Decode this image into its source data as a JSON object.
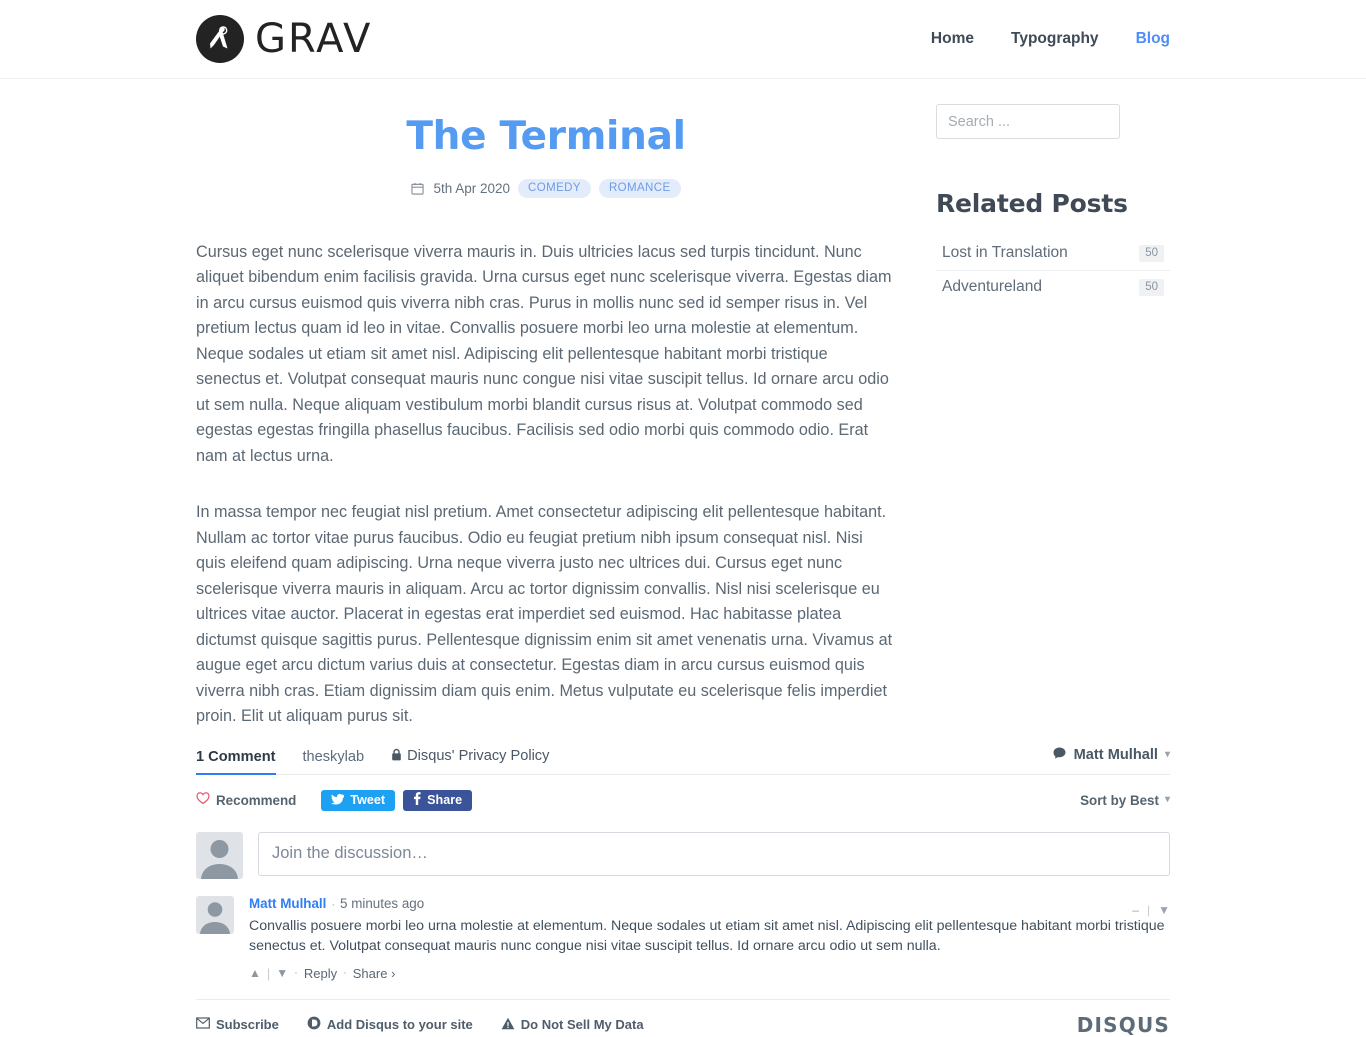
{
  "brand": {
    "word": "GRAV",
    "mark_icon": "grav-compass-logo"
  },
  "nav": {
    "items": [
      {
        "label": "Home",
        "active": false
      },
      {
        "label": "Typography",
        "active": false
      },
      {
        "label": "Blog",
        "active": true
      }
    ]
  },
  "post": {
    "title": "The Terminal",
    "date": "5th Apr 2020",
    "date_icon": "calendar-icon",
    "tags": [
      "COMEDY",
      "ROMANCE"
    ],
    "paragraphs": [
      "Cursus eget nunc scelerisque viverra mauris in. Duis ultricies lacus sed turpis tincidunt. Nunc aliquet bibendum enim facilisis gravida. Urna cursus eget nunc scelerisque viverra. Egestas diam in arcu cursus euismod quis viverra nibh cras. Purus in mollis nunc sed id semper risus in. Vel pretium lectus quam id leo in vitae. Convallis posuere morbi leo urna molestie at elementum. Neque sodales ut etiam sit amet nisl. Adipiscing elit pellentesque habitant morbi tristique senectus et. Volutpat consequat mauris nunc congue nisi vitae suscipit tellus. Id ornare arcu odio ut sem nulla. Neque aliquam vestibulum morbi blandit cursus risus at. Volutpat commodo sed egestas egestas fringilla phasellus faucibus. Facilisis sed odio morbi quis commodo odio. Erat nam at lectus urna.",
      "In massa tempor nec feugiat nisl pretium. Amet consectetur adipiscing elit pellentesque habitant. Nullam ac tortor vitae purus faucibus. Odio eu feugiat pretium nibh ipsum consequat nisl. Nisi quis eleifend quam adipiscing. Urna neque viverra justo nec ultrices dui. Cursus eget nunc scelerisque viverra mauris in aliquam. Arcu ac tortor dignissim convallis. Nisl nisi scelerisque eu ultrices vitae auctor. Placerat in egestas erat imperdiet sed euismod. Hac habitasse platea dictumst quisque sagittis purus. Pellentesque dignissim enim sit amet venenatis urna. Vivamus at augue eget arcu dictum varius duis at consectetur. Egestas diam in arcu cursus euismod quis viverra nibh cras. Etiam dignissim diam quis enim. Metus vulputate eu scelerisque felis imperdiet proin. Elit ut aliquam purus sit."
    ]
  },
  "sidebar": {
    "search": {
      "placeholder": "Search ...",
      "value": "",
      "icon": "search-field"
    },
    "related": {
      "heading": "Related Posts",
      "items": [
        {
          "title": "Lost in Translation",
          "count": "50"
        },
        {
          "title": "Adventureland",
          "count": "50"
        }
      ]
    }
  },
  "disqus": {
    "count_label": "1 Comment",
    "forum": "theskylab",
    "privacy_policy": "Disqus' Privacy Policy",
    "privacy_icon": "lock-icon",
    "user": {
      "name": "Matt Mulhall",
      "icon": "comment-bubble-icon",
      "caret": "▾"
    },
    "recommend": {
      "label": "Recommend",
      "icon": "heart-outline-icon"
    },
    "tweet": {
      "label": "Tweet",
      "icon": "twitter-bird-icon"
    },
    "share": {
      "label": "Share",
      "icon": "facebook-f-icon"
    },
    "sort": {
      "label": "Sort by Best",
      "caret": "▾"
    },
    "compose": {
      "placeholder": "Join the discussion…",
      "value": "",
      "avatar_icon": "user-avatar-placeholder"
    },
    "comment": {
      "author": "Matt Mulhall",
      "separator": "·",
      "time": "5 minutes ago",
      "text": "Convallis posuere morbi leo urna molestie at elementum. Neque sodales ut etiam sit amet nisl. Adipiscing elit pellentesque habitant morbi tristique senectus et. Volutpat consequat mauris nunc congue nisi vitae suscipit tellus. Id ornare arcu odio ut sem nulla.",
      "upvote_icon": "chevron-up-icon",
      "downvote_icon": "chevron-down-icon",
      "reply_label": "Reply",
      "share_label": "Share ›",
      "collapse_icon": "minus-icon",
      "menu_icon": "caret-down-icon",
      "avatar_icon": "user-avatar-placeholder"
    },
    "footer": {
      "links": [
        {
          "label": "Subscribe",
          "icon": "envelope-icon"
        },
        {
          "label": "Add Disqus to your site",
          "icon": "disqus-d-icon"
        },
        {
          "label": "Do Not Sell My Data",
          "icon": "warning-triangle-icon"
        }
      ],
      "logo": "DISQUS"
    }
  },
  "colors": {
    "accent_blue": "#559bf2",
    "nav_active": "#4e8ef7",
    "tag_bg": "#e3ecfb",
    "tag_text": "#6f9ae4",
    "twitter": "#1da1f2",
    "facebook": "#3b5499",
    "disqus_underline": "#2e7ef4",
    "body_text": "#5b6874"
  }
}
